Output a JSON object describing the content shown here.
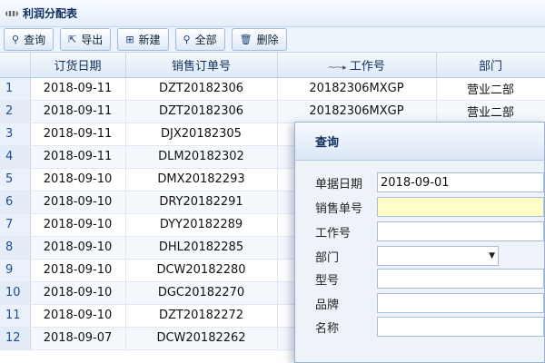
{
  "window": {
    "title": "利润分配表",
    "logo_icon": "scribble-logo-icon"
  },
  "toolbar": {
    "buttons": [
      {
        "label": "查询",
        "icon": "⚲"
      },
      {
        "label": "导出",
        "icon": "⇱"
      },
      {
        "label": "新建",
        "icon": "⊞"
      },
      {
        "label": "全部",
        "icon": "⚲"
      },
      {
        "label": "删除",
        "icon": "🗑"
      }
    ]
  },
  "grid": {
    "columns": [
      "订货日期",
      "销售订单号",
      "工作号",
      "部门"
    ],
    "rows": [
      {
        "n": "1",
        "date": "2018-09-11",
        "order": "DZT20182306",
        "work": "20182306MXGP",
        "dept": "营业二部"
      },
      {
        "n": "2",
        "date": "2018-09-11",
        "order": "DZT20182306",
        "work": "20182306MXGP",
        "dept": "营业二部"
      },
      {
        "n": "3",
        "date": "2018-09-11",
        "order": "DJX20182305",
        "work": "",
        "dept": ""
      },
      {
        "n": "4",
        "date": "2018-09-11",
        "order": "DLM20182302",
        "work": "",
        "dept": ""
      },
      {
        "n": "5",
        "date": "2018-09-10",
        "order": "DMX20182293",
        "work": "",
        "dept": ""
      },
      {
        "n": "6",
        "date": "2018-09-10",
        "order": "DRY20182291",
        "work": "",
        "dept": ""
      },
      {
        "n": "7",
        "date": "2018-09-10",
        "order": "DYY20182289",
        "work": "",
        "dept": ""
      },
      {
        "n": "8",
        "date": "2018-09-10",
        "order": "DHL20182285",
        "work": "",
        "dept": ""
      },
      {
        "n": "9",
        "date": "2018-09-10",
        "order": "DCW20182280",
        "work": "",
        "dept": ""
      },
      {
        "n": "10",
        "date": "2018-09-10",
        "order": "DGC20182270",
        "work": "",
        "dept": ""
      },
      {
        "n": "11",
        "date": "2018-09-10",
        "order": "DZT20182272",
        "work": "",
        "dept": ""
      },
      {
        "n": "12",
        "date": "2018-09-07",
        "order": "DCW20182262",
        "work": "",
        "dept": ""
      }
    ]
  },
  "dialog": {
    "title": "查询",
    "fields": {
      "date": {
        "label": "单据日期",
        "value": "2018-09-01"
      },
      "order": {
        "label": "销售单号",
        "value": ""
      },
      "work": {
        "label": "工作号",
        "value": ""
      },
      "dept": {
        "label": "部门",
        "value": ""
      },
      "model": {
        "label": "型号",
        "value": ""
      },
      "brand": {
        "label": "品牌",
        "value": ""
      },
      "name": {
        "label": "名称",
        "value": ""
      }
    }
  },
  "colors": {
    "header_text": "#0e2d5f",
    "highlight_input": "#ffffc8"
  }
}
